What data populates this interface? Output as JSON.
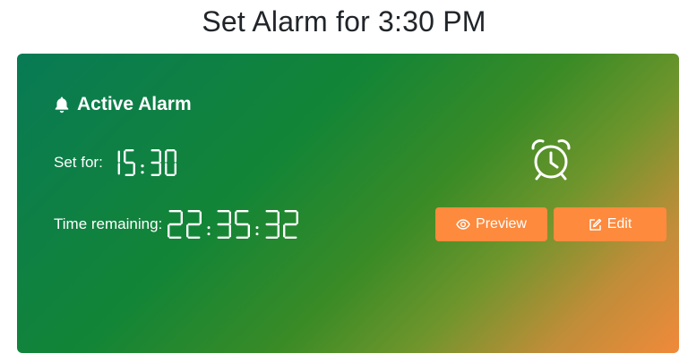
{
  "page": {
    "title": "Set Alarm for 3:30 PM"
  },
  "card": {
    "header": {
      "icon": "bell-icon",
      "title": "Active Alarm"
    },
    "set_for": {
      "label": "Set for:",
      "value": "15:30"
    },
    "remaining": {
      "label": "Time remaining:",
      "value": "22:35:32"
    },
    "alarm_icon": "alarm-clock-icon",
    "buttons": {
      "preview": {
        "label": "Preview",
        "icon": "eye-icon"
      },
      "edit": {
        "label": "Edit",
        "icon": "edit-icon"
      }
    }
  },
  "colors": {
    "gradient_start": "#087a55",
    "gradient_end": "#f08a3a",
    "button": "#fd8a3d",
    "text": "#ffffff"
  }
}
